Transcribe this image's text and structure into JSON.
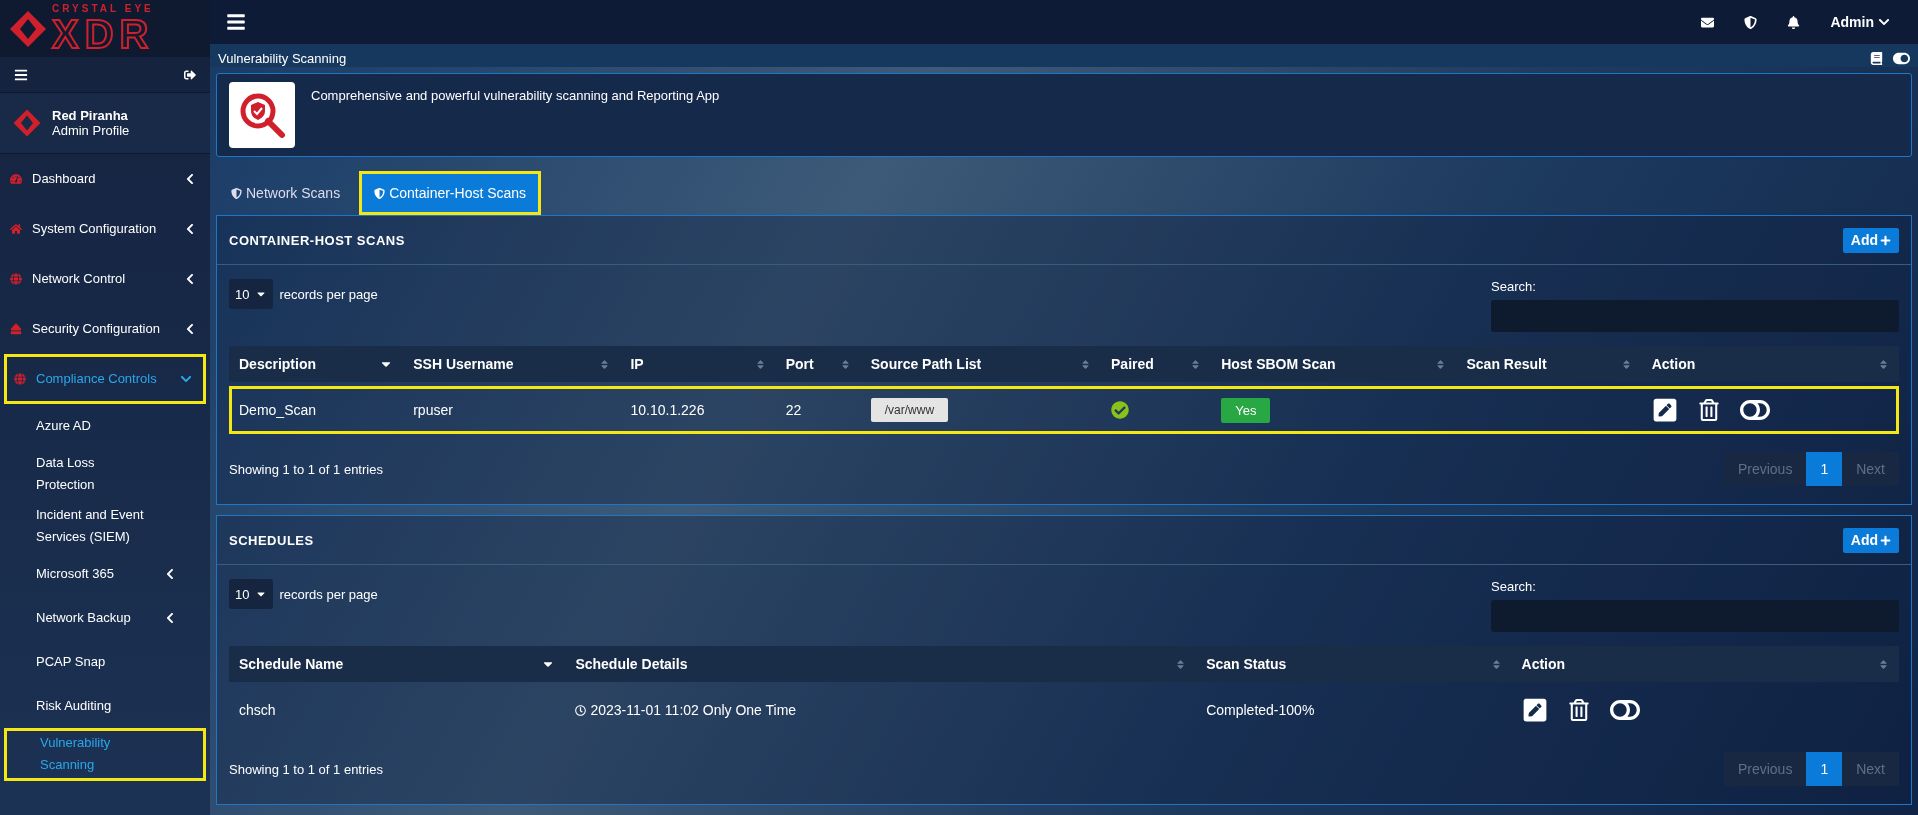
{
  "header": {
    "user": "Admin"
  },
  "sidebar": {
    "logo": {
      "top": "CRYSTAL EYE",
      "main": "XDR"
    },
    "profile": {
      "name": "Red Piranha",
      "role": "Admin Profile"
    },
    "items": [
      {
        "label": "Dashboard",
        "expanded": false,
        "selected": false,
        "highlighted": false
      },
      {
        "label": "System Configuration",
        "expanded": false,
        "selected": false,
        "highlighted": false
      },
      {
        "label": "Network Control",
        "expanded": false,
        "selected": false,
        "highlighted": false
      },
      {
        "label": "Security Configuration",
        "expanded": false,
        "selected": false,
        "highlighted": false
      },
      {
        "label": "Compliance Controls",
        "expanded": true,
        "selected": true,
        "highlighted": true,
        "children": [
          {
            "label": "Azure AD",
            "selected": false,
            "highlighted": false
          },
          {
            "label": "Data Loss Protection",
            "selected": false,
            "highlighted": false
          },
          {
            "label": "Incident and Event Services (SIEM)",
            "selected": false,
            "highlighted": false
          },
          {
            "label": "Microsoft 365",
            "expanded": false,
            "selected": false,
            "highlighted": false
          },
          {
            "label": "Network Backup",
            "expanded": false,
            "selected": false,
            "highlighted": false
          },
          {
            "label": "PCAP Snap",
            "selected": false,
            "highlighted": false
          },
          {
            "label": "Risk Auditing",
            "selected": false,
            "highlighted": false
          },
          {
            "label": "Vulnerability Scanning",
            "selected": true,
            "highlighted": true
          }
        ]
      }
    ]
  },
  "page": {
    "title": "Vulnerability Scanning",
    "app_description": "Comprehensive and powerful vulnerability scanning and Reporting App"
  },
  "tabs": [
    {
      "label": "Network Scans",
      "selected": false,
      "highlighted": false
    },
    {
      "label": "Container-Host Scans",
      "selected": true,
      "highlighted": true
    }
  ],
  "panels": [
    {
      "title": "CONTAINER-HOST SCANS",
      "add_label": "Add",
      "page_length": "10",
      "length_label": "records per page",
      "search_label": "Search:",
      "columns": [
        {
          "label": "Description",
          "sorted": true
        },
        {
          "label": "SSH Username",
          "sorted": false
        },
        {
          "label": "IP",
          "sorted": false
        },
        {
          "label": "Port",
          "sorted": false
        },
        {
          "label": "Source Path List",
          "sorted": false
        },
        {
          "label": "Paired",
          "sorted": false
        },
        {
          "label": "Host SBOM Scan",
          "sorted": false
        },
        {
          "label": "Scan Result",
          "sorted": false
        },
        {
          "label": "Action",
          "sorted": false
        }
      ],
      "rows": [
        {
          "highlighted": true,
          "cells": [
            {
              "kind": "text",
              "text": "Demo_Scan"
            },
            {
              "kind": "text",
              "text": "rpuser"
            },
            {
              "kind": "text",
              "text": "10.10.1.226"
            },
            {
              "kind": "text",
              "text": "22"
            },
            {
              "kind": "tag",
              "text": "/var/www"
            },
            {
              "kind": "check",
              "checked": true
            },
            {
              "kind": "badge",
              "text": "Yes"
            },
            {
              "kind": "empty"
            },
            {
              "kind": "actions",
              "on": false
            }
          ]
        }
      ],
      "info": "Showing 1 to 1 of 1 entries",
      "pagination": {
        "previous": {
          "label": "Previous",
          "disabled": true
        },
        "pages": [
          {
            "label": "1",
            "selected": true
          }
        ],
        "next": {
          "label": "Next",
          "disabled": true
        }
      }
    },
    {
      "title": "SCHEDULES",
      "add_label": "Add",
      "page_length": "10",
      "length_label": "records per page",
      "search_label": "Search:",
      "columns": [
        {
          "label": "Schedule Name",
          "sorted": true
        },
        {
          "label": "Schedule Details",
          "sorted": false
        },
        {
          "label": "Scan Status",
          "sorted": false
        },
        {
          "label": "Action",
          "sorted": false
        }
      ],
      "rows": [
        {
          "highlighted": false,
          "cells": [
            {
              "kind": "text",
              "text": "chsch"
            },
            {
              "kind": "clock",
              "text": "2023-11-01 11:02 Only One Time"
            },
            {
              "kind": "text",
              "text": "Completed-100%"
            },
            {
              "kind": "actions",
              "on": false
            }
          ]
        }
      ],
      "info": "Showing 1 to 1 of 1 entries",
      "pagination": {
        "previous": {
          "label": "Previous",
          "disabled": true
        },
        "pages": [
          {
            "label": "1",
            "selected": true
          }
        ],
        "next": {
          "label": "Next",
          "disabled": true
        }
      }
    }
  ]
}
